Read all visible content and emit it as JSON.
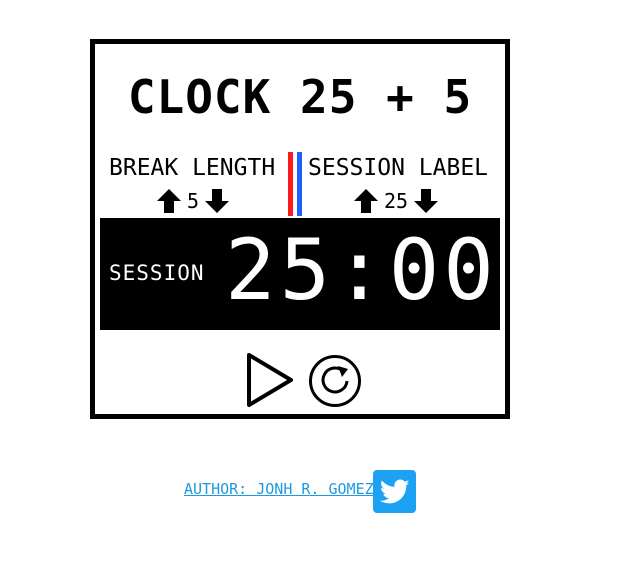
{
  "title": "CLOCK 25 + 5",
  "break": {
    "label": "BREAK LENGTH",
    "value": "5",
    "increment_icon": "arrow-up-icon",
    "decrement_icon": "arrow-down-icon"
  },
  "session": {
    "label": "SESSION LABEL",
    "value": "25",
    "increment_icon": "arrow-up-icon",
    "decrement_icon": "arrow-down-icon"
  },
  "timer": {
    "label": "SESSION",
    "time_left": "25:00"
  },
  "controls": {
    "play_icon": "play-icon",
    "reset_icon": "refresh-icon"
  },
  "footer": {
    "author_text": "AUTHOR: JONH R. GOMEZ",
    "twitter_icon": "twitter-icon"
  },
  "colors": {
    "frame": "#000000",
    "display_bg": "#000000",
    "display_text": "#ffffff",
    "divider_red": "#ff1a1a",
    "divider_blue": "#1f5eff",
    "link": "#1e9ae0",
    "twitter_bg": "#1da1f2"
  }
}
